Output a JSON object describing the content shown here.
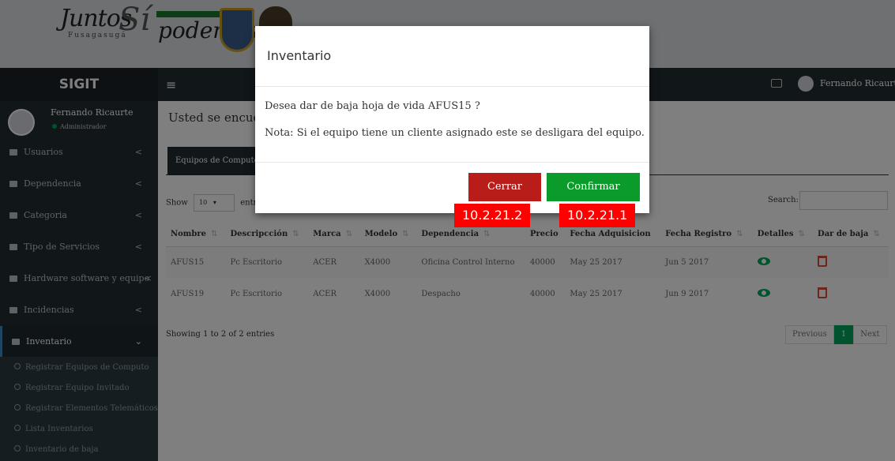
{
  "banner": {
    "logo_text": "Juntos",
    "logo_sub": "Fusagasugá",
    "logo_si": "Sí",
    "logo_text2": "podemos"
  },
  "topnav": {
    "brand": "SIGIT",
    "hamburger": "≡",
    "user_name": "Fernando Ricaurte"
  },
  "sidebar": {
    "user_name": "Fernando Ricaurte",
    "user_role": "Administrador",
    "items": [
      {
        "label": "Usuarios",
        "chevron": "<"
      },
      {
        "label": "Dependencia",
        "chevron": "<"
      },
      {
        "label": "Categoria",
        "chevron": "<"
      },
      {
        "label": "Tipo de Servicios",
        "chevron": "<"
      },
      {
        "label": "Hardware software y equipo",
        "chevron": "<"
      },
      {
        "label": "Incidencias",
        "chevron": "<"
      },
      {
        "label": "Inventario",
        "chevron": "⌄"
      }
    ],
    "subitems": [
      "Registrar Equipos de Computo",
      "Registrar Equipo Invitado",
      "Registrar Elementos Telemáticos",
      "Lista Inventarios",
      "Inventario de baja"
    ]
  },
  "content": {
    "title": "Usted se encuent",
    "tab_active": "Equipos de Computo",
    "show_label": "Show",
    "show_value": "10",
    "entries_label": "entr",
    "search_label": "Search:",
    "columns": [
      "Nombre",
      "Descripcción",
      "Marca",
      "Modelo",
      "Dependencia",
      "Precio",
      "Fecha Adquisicion",
      "Fecha Registro",
      "Detalles",
      "Dar de baja"
    ],
    "rows": [
      [
        "AFUS15",
        "Pc Escritorio",
        "ACER",
        "X4000",
        "Oficina Control Interno",
        "40000",
        "May 25 2017",
        "Jun 5 2017"
      ],
      [
        "AFUS19",
        "Pc Escritorio",
        "ACER",
        "X4000",
        "Despacho",
        "40000",
        "May 25 2017",
        "Jun 9 2017"
      ]
    ],
    "showing": "Showing 1 to 2 of 2 entries",
    "pager": {
      "previous": "Previous",
      "page": "1",
      "next": "Next"
    }
  },
  "modal": {
    "title": "Inventario",
    "message": "Desea dar de baja hoja de vida AFUS15 ?",
    "note": "Nota: Si el equipo tiene un cliente asignado este se desligara del equipo.",
    "cerrar": "Cerrar",
    "confirmar": "Confirmar"
  },
  "tags": {
    "cerrar_tag": "10.2.21.2",
    "confirmar_tag": "10.2.21.1"
  }
}
